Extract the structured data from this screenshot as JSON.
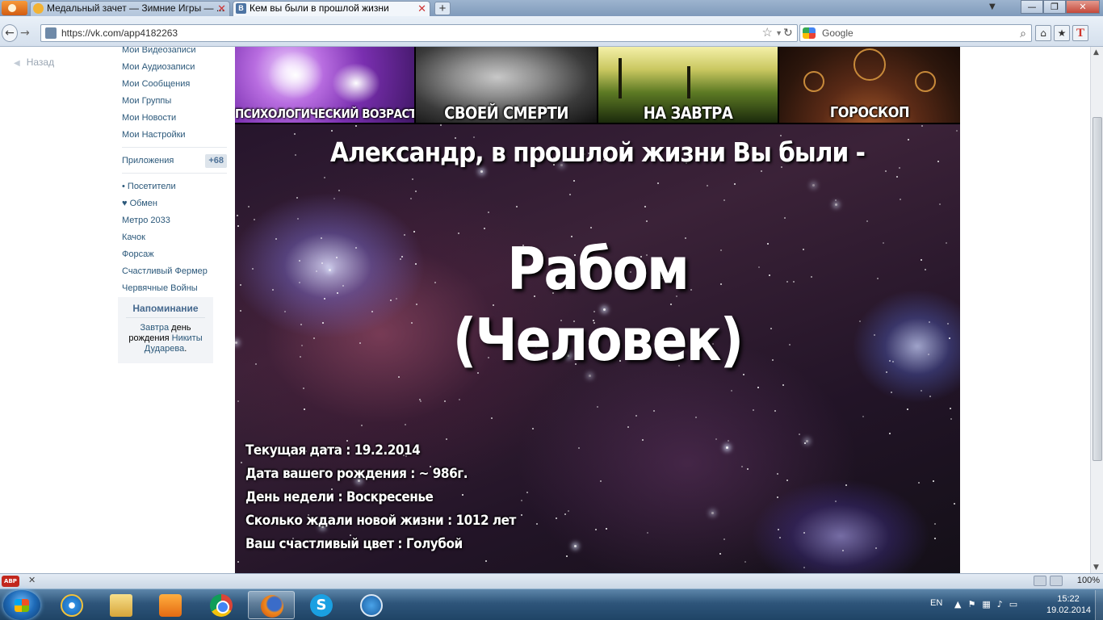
{
  "browser": {
    "tabs": [
      {
        "title": "Медальный зачет — Зимние Игры — ...",
        "active": false
      },
      {
        "title": "Кем вы были в прошлой жизни",
        "active": true
      }
    ],
    "new_tab_label": "+",
    "url": "https://vk.com/app4182263",
    "search_placeholder": "Google",
    "window_buttons": {
      "minimize": "—",
      "maximize": "❐",
      "close": "✕"
    }
  },
  "sidebar": {
    "back_label": "Назад",
    "menu_items": [
      "Мои Видеозаписи",
      "Мои Аудиозаписи",
      "Мои Сообщения",
      "Мои Группы",
      "Мои Новости",
      "Мои Настройки"
    ],
    "apps_label": "Приложения",
    "apps_badge": "+68",
    "app_items": [
      "• Посетители",
      "♥ Обмен",
      "Метро 2033",
      "Качок",
      "Форсаж",
      "Счастливый Фермер",
      "Червячные Войны"
    ],
    "reminder": {
      "title": "Напоминание",
      "word_tomorrow": "Завтра",
      "word_day": " день рождения ",
      "person": "Никиты Дударева",
      "period": "."
    }
  },
  "app": {
    "banners": [
      "ПСИХОЛОГИЧЕСКИЙ ВОЗРАСТ",
      "СВОЕЙ СМЕРТИ",
      "НА ЗАВТРА",
      "ГОРОСКОП"
    ],
    "headline": "Александр, в прошлой жизни Вы были -",
    "result_line1": "Рабом",
    "result_line2": "(Человек)",
    "info_lines": [
      "Текущая дата : 19.2.2014",
      "Дата вашего рождения : ~ 986г.",
      "День недели : Воскресенье",
      "Сколько ждали новой жизни : 1012 лет",
      "Ваш счастливый цвет : Голубой"
    ]
  },
  "addon_bar": {
    "abp_label": "ABP",
    "close": "✕",
    "zoom": "100%"
  },
  "taskbar": {
    "apps": [
      "internet-explorer",
      "windows-explorer",
      "media-player",
      "chrome",
      "firefox",
      "skype",
      "download-manager"
    ],
    "active_app": "firefox",
    "language": "EN",
    "time": "15:22",
    "date": "19.02.2014"
  }
}
